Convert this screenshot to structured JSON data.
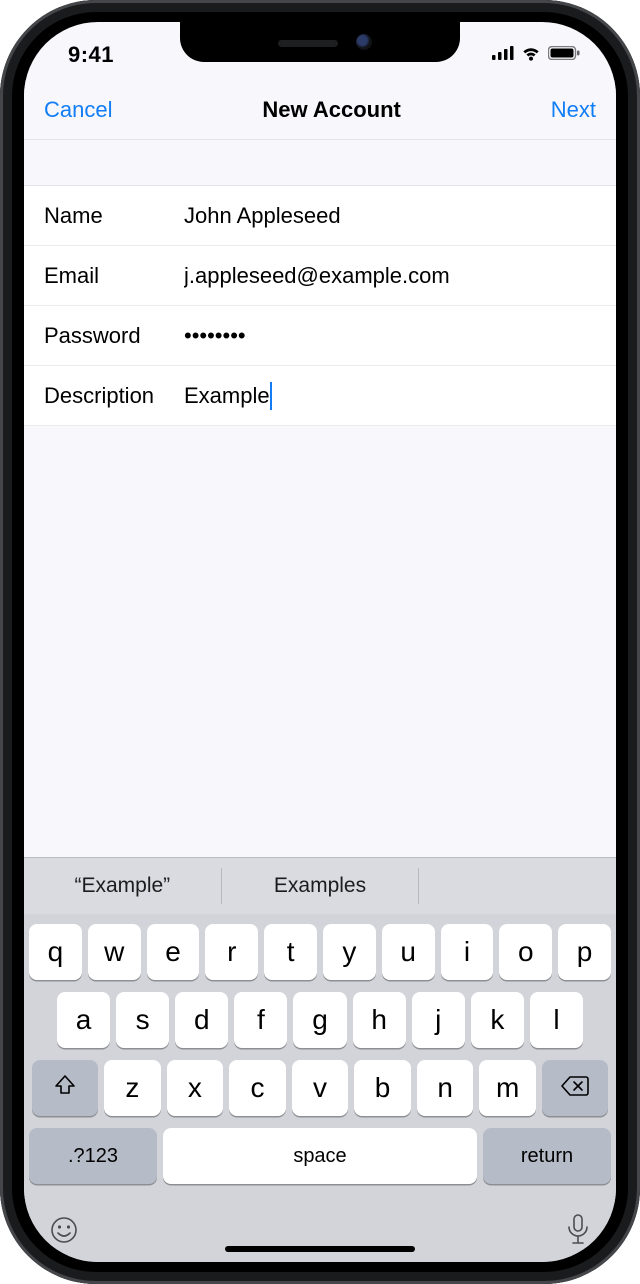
{
  "status": {
    "time": "9:41"
  },
  "nav": {
    "cancel": "Cancel",
    "title": "New Account",
    "next": "Next"
  },
  "form": {
    "rows": [
      {
        "label": "Name",
        "value": "John Appleseed",
        "type": "text"
      },
      {
        "label": "Email",
        "value": "j.appleseed@example.com",
        "type": "text"
      },
      {
        "label": "Password",
        "value": "••••••••",
        "type": "password"
      },
      {
        "label": "Description",
        "value": "Example",
        "type": "text",
        "focused": true
      }
    ]
  },
  "suggestions": [
    "“Example”",
    "Examples",
    ""
  ],
  "keyboard": {
    "row1": [
      "q",
      "w",
      "e",
      "r",
      "t",
      "y",
      "u",
      "i",
      "o",
      "p"
    ],
    "row2": [
      "a",
      "s",
      "d",
      "f",
      "g",
      "h",
      "j",
      "k",
      "l"
    ],
    "row3": [
      "z",
      "x",
      "c",
      "v",
      "b",
      "n",
      "m"
    ],
    "numbers_label": ".?123",
    "space_label": "space",
    "return_label": "return"
  }
}
